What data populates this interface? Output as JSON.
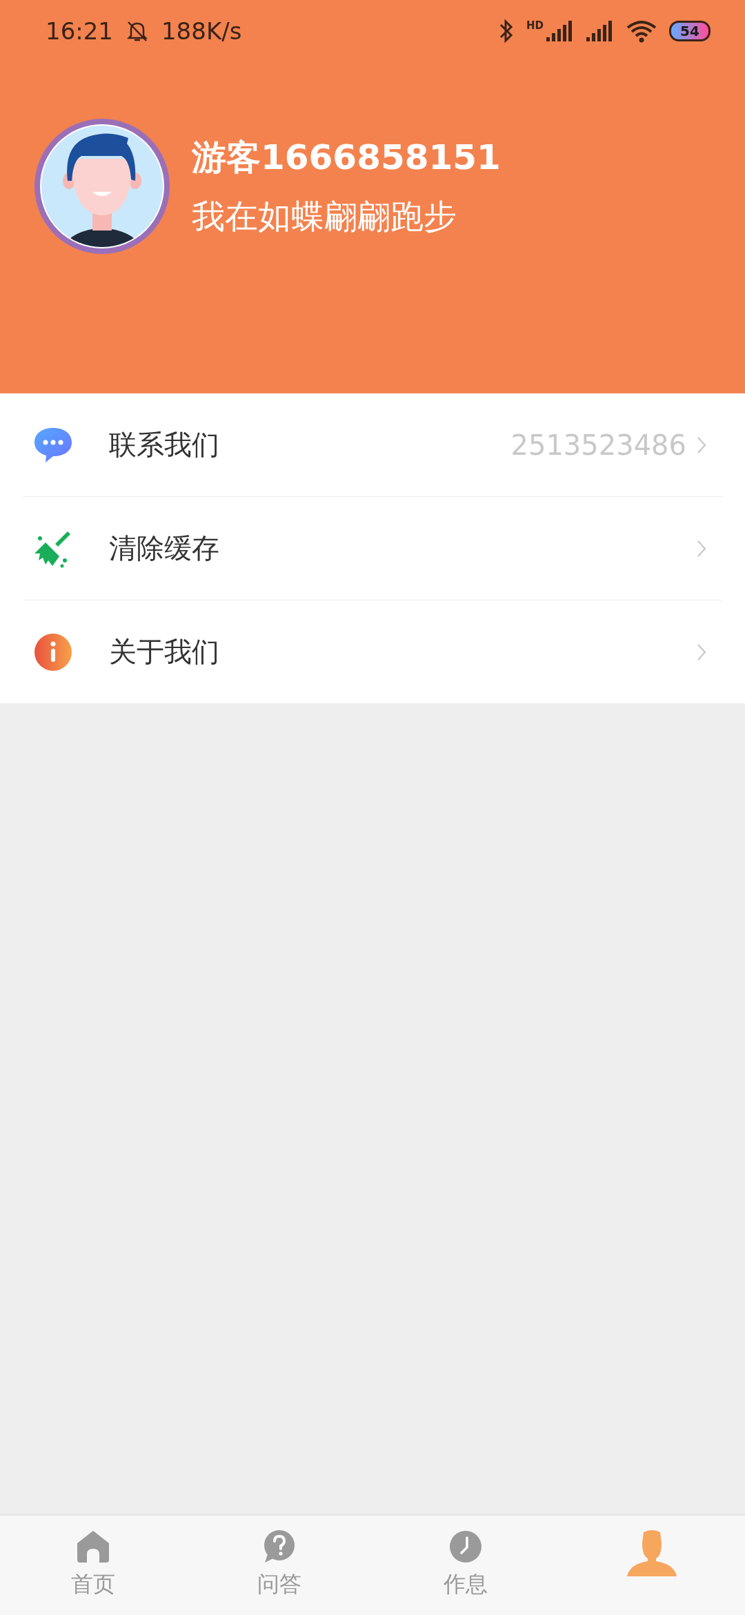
{
  "status_bar": {
    "time": "16:21",
    "speed": "188K/s",
    "signal_label": "HD",
    "battery": "54"
  },
  "profile": {
    "name": "游客1666858151",
    "motto": "我在如蝶翩翩跑步"
  },
  "menu": [
    {
      "kind": "contact",
      "label": "联系我们",
      "value": "2513523486"
    },
    {
      "kind": "clear",
      "label": "清除缓存"
    },
    {
      "kind": "about",
      "label": "关于我们"
    }
  ],
  "tabs": [
    {
      "kind": "home",
      "label": "首页",
      "selected": false
    },
    {
      "kind": "qa",
      "label": "问答",
      "selected": false
    },
    {
      "kind": "rest",
      "label": "作息",
      "selected": false
    },
    {
      "kind": "me",
      "selected": true
    }
  ]
}
